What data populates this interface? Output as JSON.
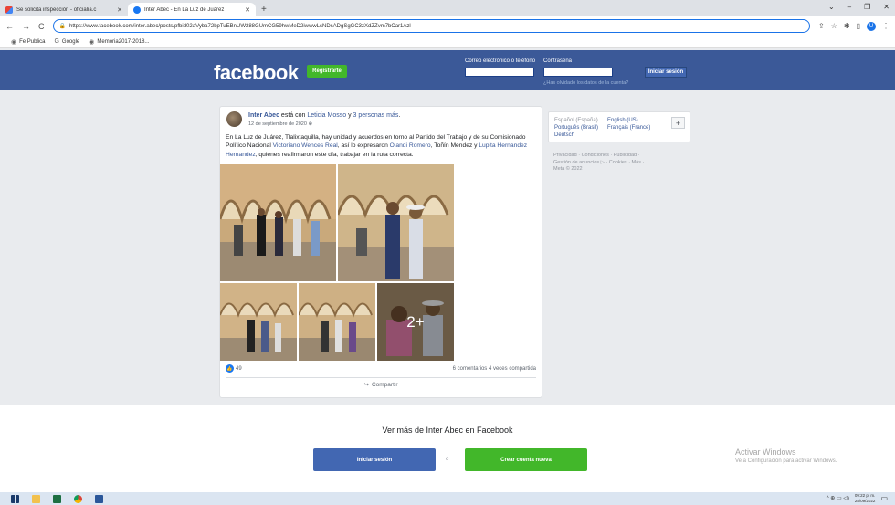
{
  "browser": {
    "tabs": [
      {
        "title": "Se solicita inspección - oficialia.c",
        "icon": "gmail-icon",
        "active": false
      },
      {
        "title": "Inter Abec - En La Luz de Juárez",
        "icon": "facebook-icon",
        "active": true
      }
    ],
    "new_tab": "+",
    "url": "https://www.facebook.com/inter.abec/posts/pfbid02aVyba72bpTuEBnUW288GUmCG59hwMeD2iwwwLsNDsADgSgGC3zXdZZvm7bCar1Azl",
    "bookmarks": [
      "Fe Publica",
      "Google",
      "Memoria2017-2018..."
    ],
    "profile_initial": "U"
  },
  "fb_header": {
    "logo": "facebook",
    "register": "Registrarte",
    "email_label": "Correo electrónico o teléfono",
    "password_label": "Contraseña",
    "login": "Iniciar sesión",
    "forgot": "¿Has olvidado los datos de la cuenta?"
  },
  "post": {
    "author": "Inter Abec",
    "with_text": " está con ",
    "tagged": "Leticia Mosso",
    "and_text": " y ",
    "others": "3 personas más",
    "dot": ".",
    "date": "12 de septiembre de 2020",
    "body": {
      "t1": "En La Luz de Juárez, Tlalixtaquilla, hay unidad y acuerdos en torno al Partido del Trabajo y de su Comisionado Político Nacional ",
      "l1": "Victoriano Wences Real",
      "t2": ", así lo expresaron ",
      "l2": "Olandi Romero",
      "t3": ", Toñín Mendez y ",
      "l3": "Lupita Hernandez Hernandez",
      "t4": ", quienes reafirmaron este día, trabajar en la ruta correcta."
    },
    "more_photos": "2+",
    "likes": "49",
    "comments": "6 comentarios",
    "shares": "4 veces compartida",
    "share_button": "Compartir"
  },
  "sidebar": {
    "languages": [
      "Español (España)",
      "English (US)",
      "Português (Brasil)",
      "Français (France)",
      "Deutsch"
    ],
    "add_language": "+",
    "footer_links": "Privacidad · Condiciones · Publicidad · Gestión de anuncios ▷ · Cookies · Más ·",
    "copyright": "Meta © 2022"
  },
  "cta": {
    "title": "Ver más de Inter Abec en Facebook",
    "login": "Iniciar sesión",
    "or": "o",
    "create": "Crear cuenta nueva"
  },
  "watermark": {
    "line1": "Activar Windows",
    "line2": "Ve a Configuración para activar Windows."
  },
  "taskbar": {
    "time": "09:22 p. m.",
    "date": "28/09/2022",
    "tray_icons": "^ ⊕ ▭ ◁)"
  },
  "colors": {
    "fb_blue": "#3b5998",
    "fb_green": "#42b72a",
    "link": "#385898"
  }
}
